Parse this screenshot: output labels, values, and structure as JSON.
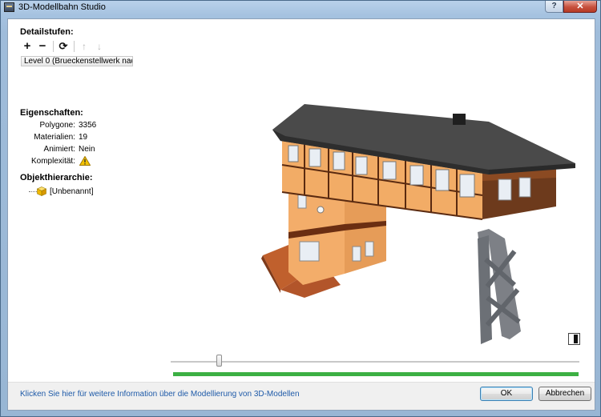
{
  "window": {
    "title": "3D-Modellbahn Studio",
    "help_label": "?",
    "close_label": "✕"
  },
  "detail_levels": {
    "heading": "Detailstufen:",
    "toolbar": {
      "add_label": "+",
      "remove_label": "−",
      "refresh_label": "⟳",
      "up_label": "↑",
      "down_label": "↓"
    },
    "selected_level": "Level 0 (Brueckenstellwerk nach..."
  },
  "properties": {
    "heading": "Eigenschaften:",
    "rows": [
      {
        "label": "Polygone:",
        "value": "3356"
      },
      {
        "label": "Materialien:",
        "value": "19"
      },
      {
        "label": "Animiert:",
        "value": "Nein"
      },
      {
        "label": "Komplexität:",
        "value": ""
      }
    ]
  },
  "hierarchy": {
    "heading": "Objekthierarchie:",
    "items": [
      {
        "label": "[Unbenannt]"
      }
    ]
  },
  "viewer": {
    "slider_fraction": 0.12,
    "progress_fraction": 1.0,
    "progress_color": "#3cb043"
  },
  "footer": {
    "info_link": "Klicken Sie hier für weitere Information über die Modellierung von 3D-Modellen",
    "ok_label": "OK",
    "cancel_label": "Abbrechen"
  },
  "colors": {
    "link": "#1e5aa8",
    "warning": "#f5c400"
  }
}
